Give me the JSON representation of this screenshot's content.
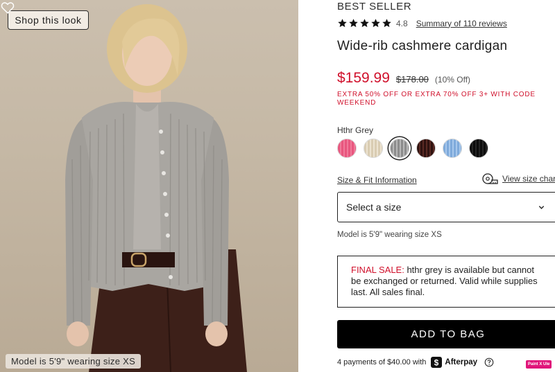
{
  "image": {
    "shop_look_label": "Shop this look",
    "model_caption": "Model is 5'9\" wearing size XS"
  },
  "product": {
    "badge": "BEST SELLER",
    "rating": 4.8,
    "rating_text": "4.8",
    "reviews_link": "Summary of 110 reviews",
    "title": "Wide-rib cashmere cardigan"
  },
  "pricing": {
    "sale_price": "$159.99",
    "original_price": "$178.00",
    "discount": "(10% Off)",
    "promo": "EXTRA 50% OFF OR EXTRA 70% OFF 3+ WITH CODE WEEKEND",
    "sale_color": "#d0102b"
  },
  "color": {
    "label": "Hthr Grey",
    "swatches": [
      {
        "name": "pink",
        "hex": "#e8567e"
      },
      {
        "name": "natural",
        "hex": "#ddd0b8"
      },
      {
        "name": "hthr-grey",
        "hex": "#9a9a9a",
        "selected": true
      },
      {
        "name": "brown",
        "hex": "#3a1a16"
      },
      {
        "name": "light-blue",
        "hex": "#8cb6e2"
      },
      {
        "name": "black",
        "hex": "#111111"
      }
    ]
  },
  "size": {
    "fit_link": "Size & Fit Information",
    "chart_link": "View size chart",
    "select_placeholder": "Select a size",
    "model_info": "Model is 5'9\" wearing size XS"
  },
  "final_sale": {
    "label": "FINAL SALE:",
    "text": " hthr grey is available but cannot be exchanged or returned. Valid while supplies last. All sales final."
  },
  "cart": {
    "add_label": "ADD TO BAG"
  },
  "payment": {
    "installments": "4 payments of $40.00 with",
    "provider": "Afterpay"
  },
  "badge": {
    "label": "Paint X Ule"
  },
  "icons": {
    "heart": "heart-icon",
    "star": "star-icon",
    "tape": "measuring-tape-icon",
    "chevron": "chevron-down-icon",
    "afterpay": "afterpay-logo-icon",
    "help": "question-circle-icon"
  }
}
